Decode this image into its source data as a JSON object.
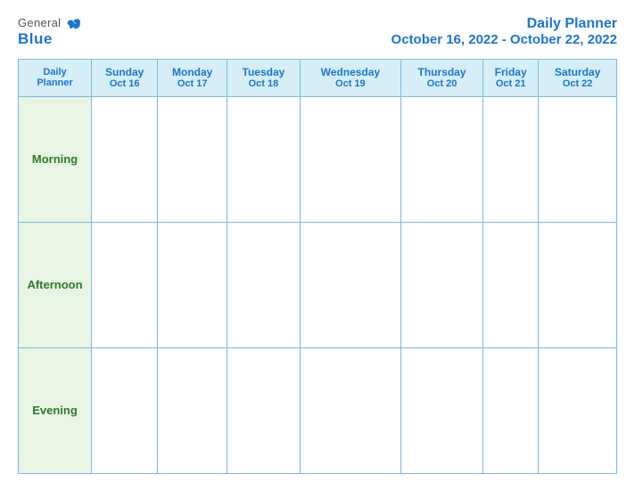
{
  "header": {
    "logo_general": "General",
    "logo_blue": "Blue",
    "title_line1": "Daily Planner",
    "title_line2": "October 16, 2022 - October 22, 2022"
  },
  "table": {
    "col0": {
      "line1": "Daily",
      "line2": "Planner",
      "date": ""
    },
    "columns": [
      {
        "day": "Sunday",
        "date": "Oct 16"
      },
      {
        "day": "Monday",
        "date": "Oct 17"
      },
      {
        "day": "Tuesday",
        "date": "Oct 18"
      },
      {
        "day": "Wednesday",
        "date": "Oct 19"
      },
      {
        "day": "Thursday",
        "date": "Oct 20"
      },
      {
        "day": "Friday",
        "date": "Oct 21"
      },
      {
        "day": "Saturday",
        "date": "Oct 22"
      }
    ],
    "rows": [
      {
        "label": "Morning"
      },
      {
        "label": "Afternoon"
      },
      {
        "label": "Evening"
      }
    ]
  }
}
